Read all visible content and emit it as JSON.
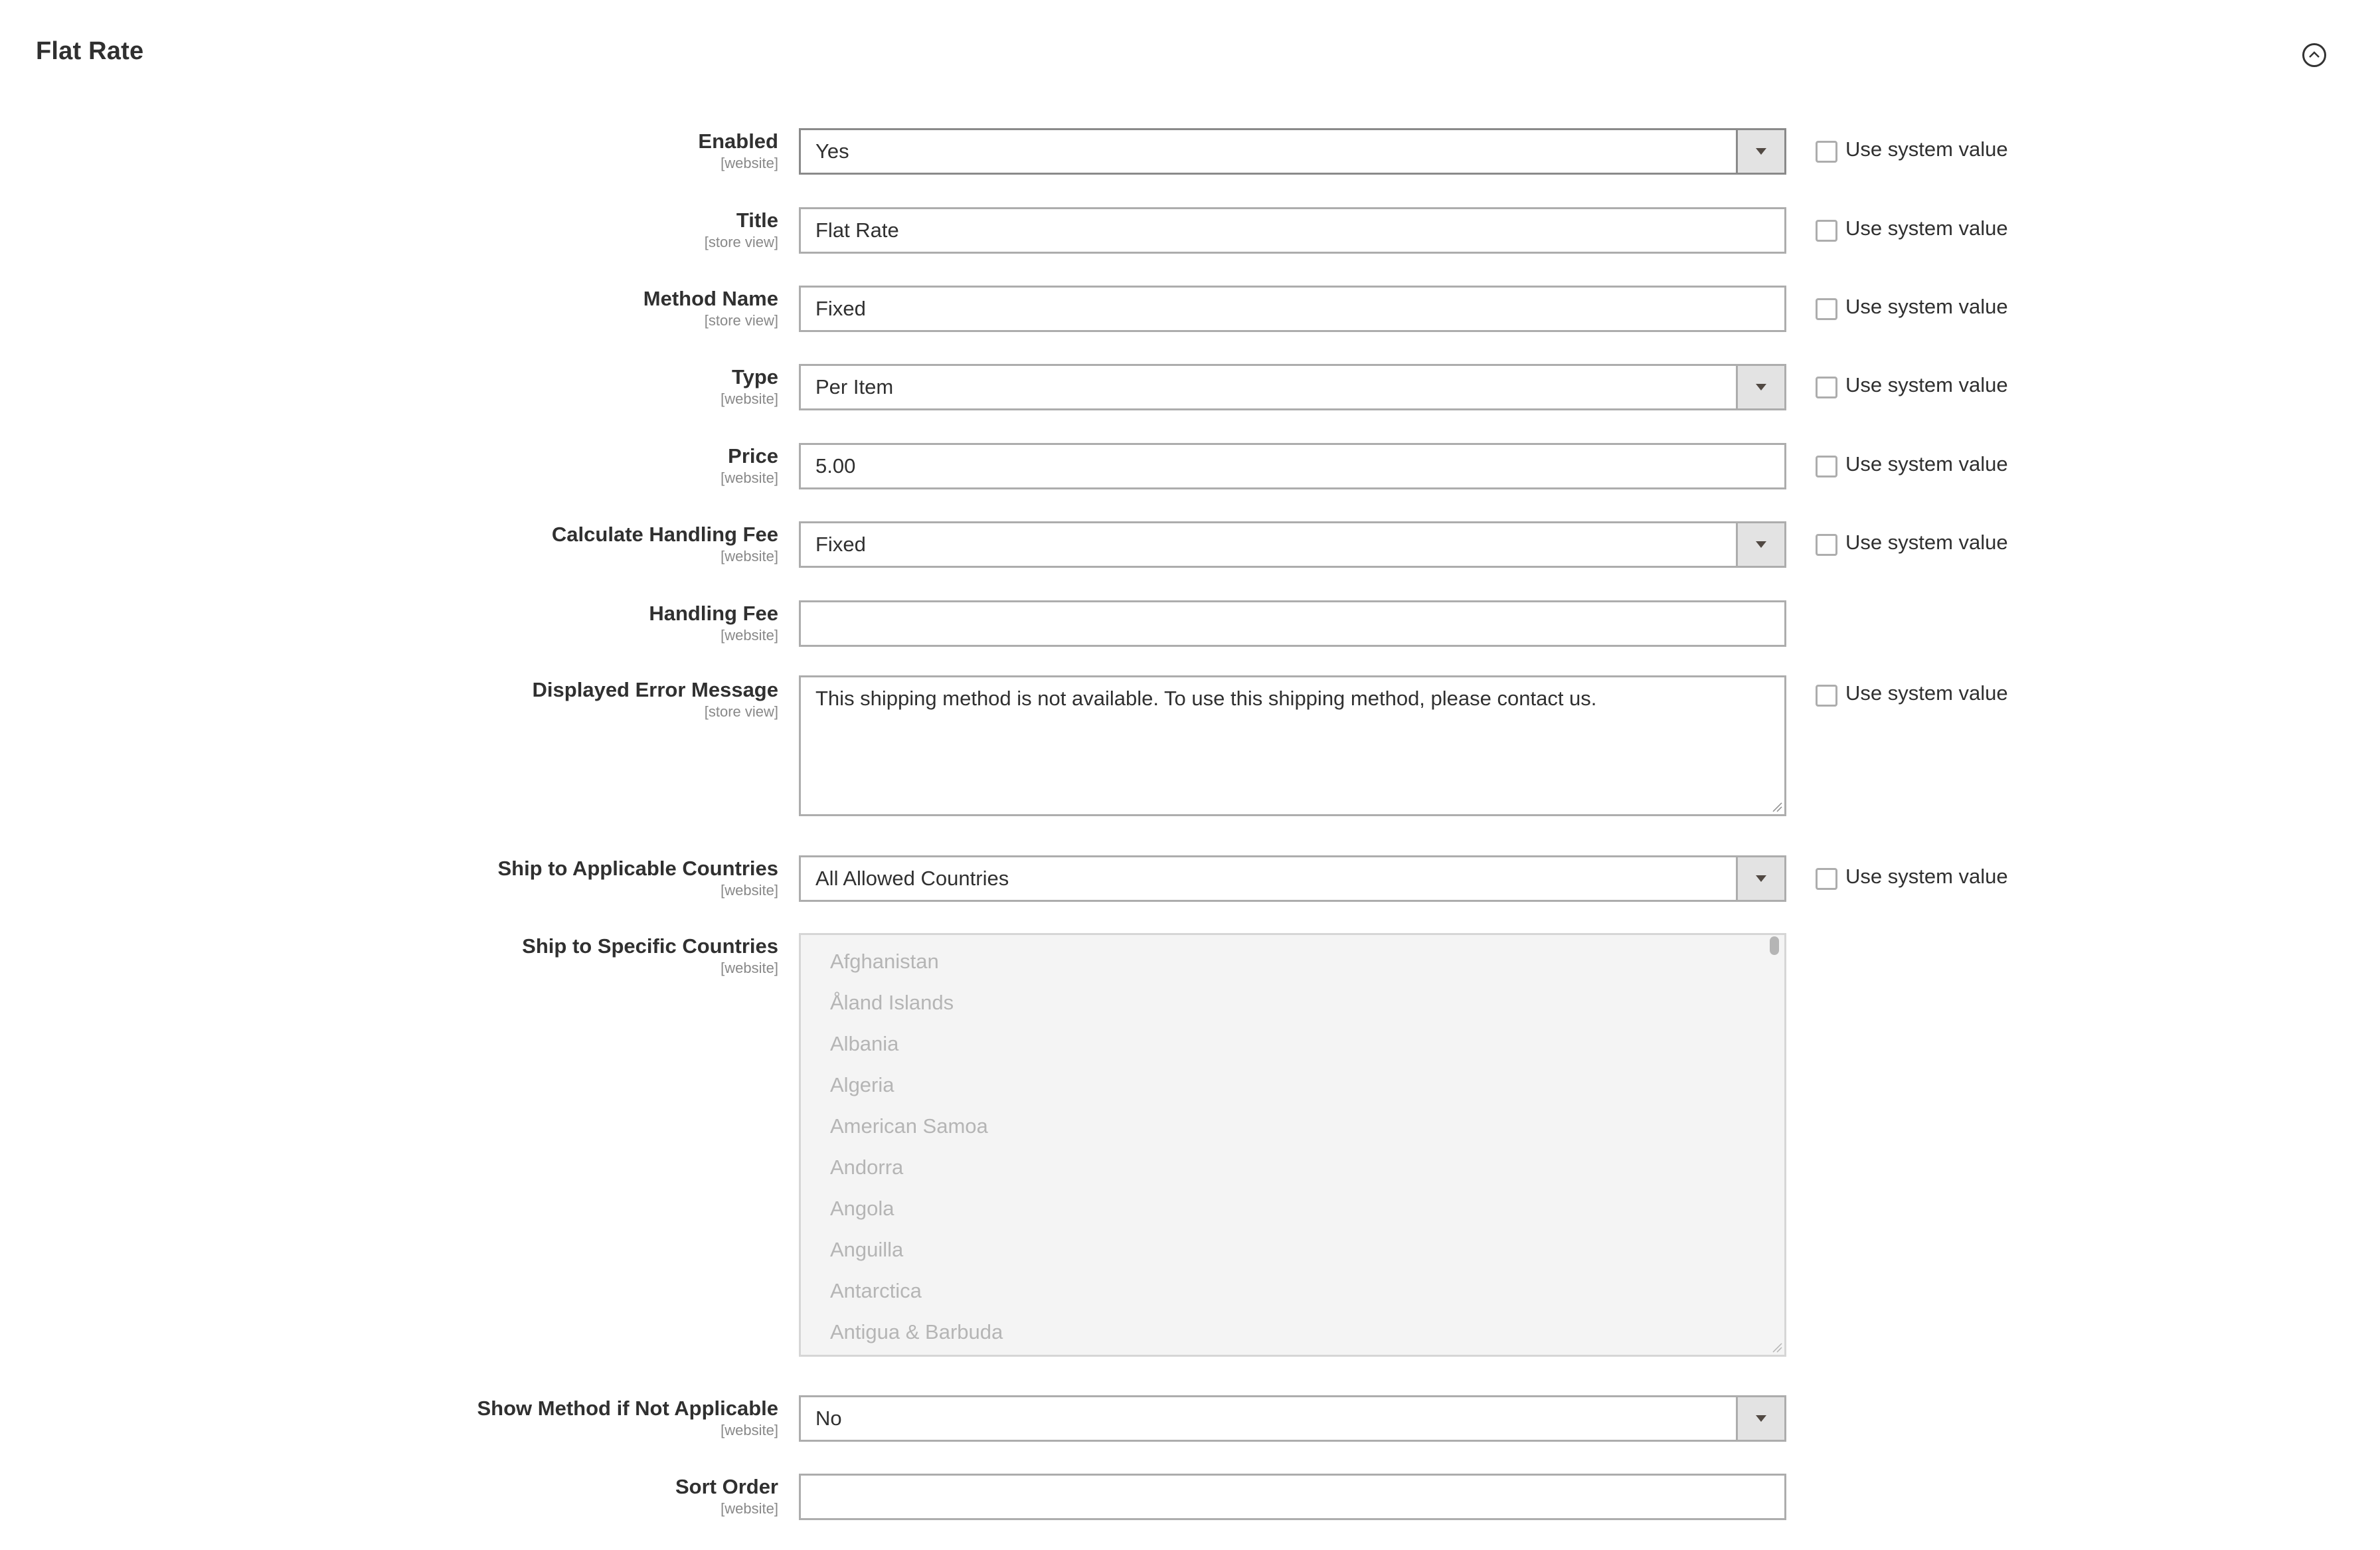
{
  "section": {
    "title": "Flat Rate",
    "collapse_icon": "chevron-up-circle-icon"
  },
  "system_value_label": "Use system value",
  "fields": {
    "enabled": {
      "label": "Enabled",
      "scope": "[website]",
      "type": "select",
      "value": "Yes",
      "use_system_value": false
    },
    "title": {
      "label": "Title",
      "scope": "[store view]",
      "type": "text",
      "value": "Flat Rate",
      "use_system_value": false
    },
    "method_name": {
      "label": "Method Name",
      "scope": "[store view]",
      "type": "text",
      "value": "Fixed",
      "use_system_value": false
    },
    "type": {
      "label": "Type",
      "scope": "[website]",
      "type": "select",
      "value": "Per Item",
      "use_system_value": false
    },
    "price": {
      "label": "Price",
      "scope": "[website]",
      "type": "text",
      "value": "5.00",
      "use_system_value": false
    },
    "calc_handling_fee": {
      "label": "Calculate Handling Fee",
      "scope": "[website]",
      "type": "select",
      "value": "Fixed",
      "use_system_value": false
    },
    "handling_fee": {
      "label": "Handling Fee",
      "scope": "[website]",
      "type": "text",
      "value": ""
    },
    "error_message": {
      "label": "Displayed Error Message",
      "scope": "[store view]",
      "type": "textarea",
      "value": "This shipping method is not available. To use this shipping method, please contact us.",
      "use_system_value": false
    },
    "applicable_countries": {
      "label": "Ship to Applicable Countries",
      "scope": "[website]",
      "type": "select",
      "value": "All Allowed Countries",
      "use_system_value": false
    },
    "specific_countries": {
      "label": "Ship to Specific Countries",
      "scope": "[website]",
      "type": "multiselect",
      "disabled": true,
      "options": [
        "Afghanistan",
        "Åland Islands",
        "Albania",
        "Algeria",
        "American Samoa",
        "Andorra",
        "Angola",
        "Anguilla",
        "Antarctica",
        "Antigua & Barbuda"
      ]
    },
    "show_method": {
      "label": "Show Method if Not Applicable",
      "scope": "[website]",
      "type": "select",
      "value": "No"
    },
    "sort_order": {
      "label": "Sort Order",
      "scope": "[website]",
      "type": "text",
      "value": ""
    }
  }
}
